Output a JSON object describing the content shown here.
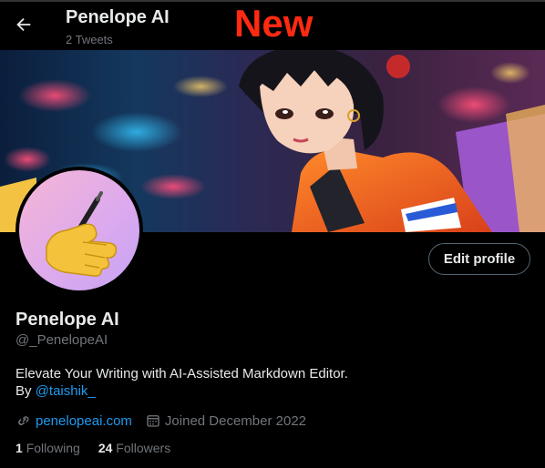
{
  "header": {
    "title": "Penelope AI",
    "tweet_count": "2 Tweets",
    "overlay_label": "New"
  },
  "profile": {
    "name": "Penelope AI",
    "handle": "@_PenelopeAI",
    "bio_line1": "Elevate Your Writing with AI-Assisted Markdown Editor.",
    "bio_by": "By ",
    "bio_mention": "@taishik_",
    "website": "penelopeai.com",
    "joined": "Joined December 2022",
    "edit_label": "Edit profile"
  },
  "stats": {
    "following_count": "1",
    "following_label": "Following",
    "followers_count": "24",
    "followers_label": "Followers"
  },
  "colors": {
    "accent": "#1d9bf0",
    "overlay": "#ff2a12",
    "muted": "#71767b"
  },
  "icons": {
    "back": "arrow-left",
    "avatar": "writing-hand-emoji",
    "website": "link-icon",
    "joined": "calendar-icon"
  }
}
